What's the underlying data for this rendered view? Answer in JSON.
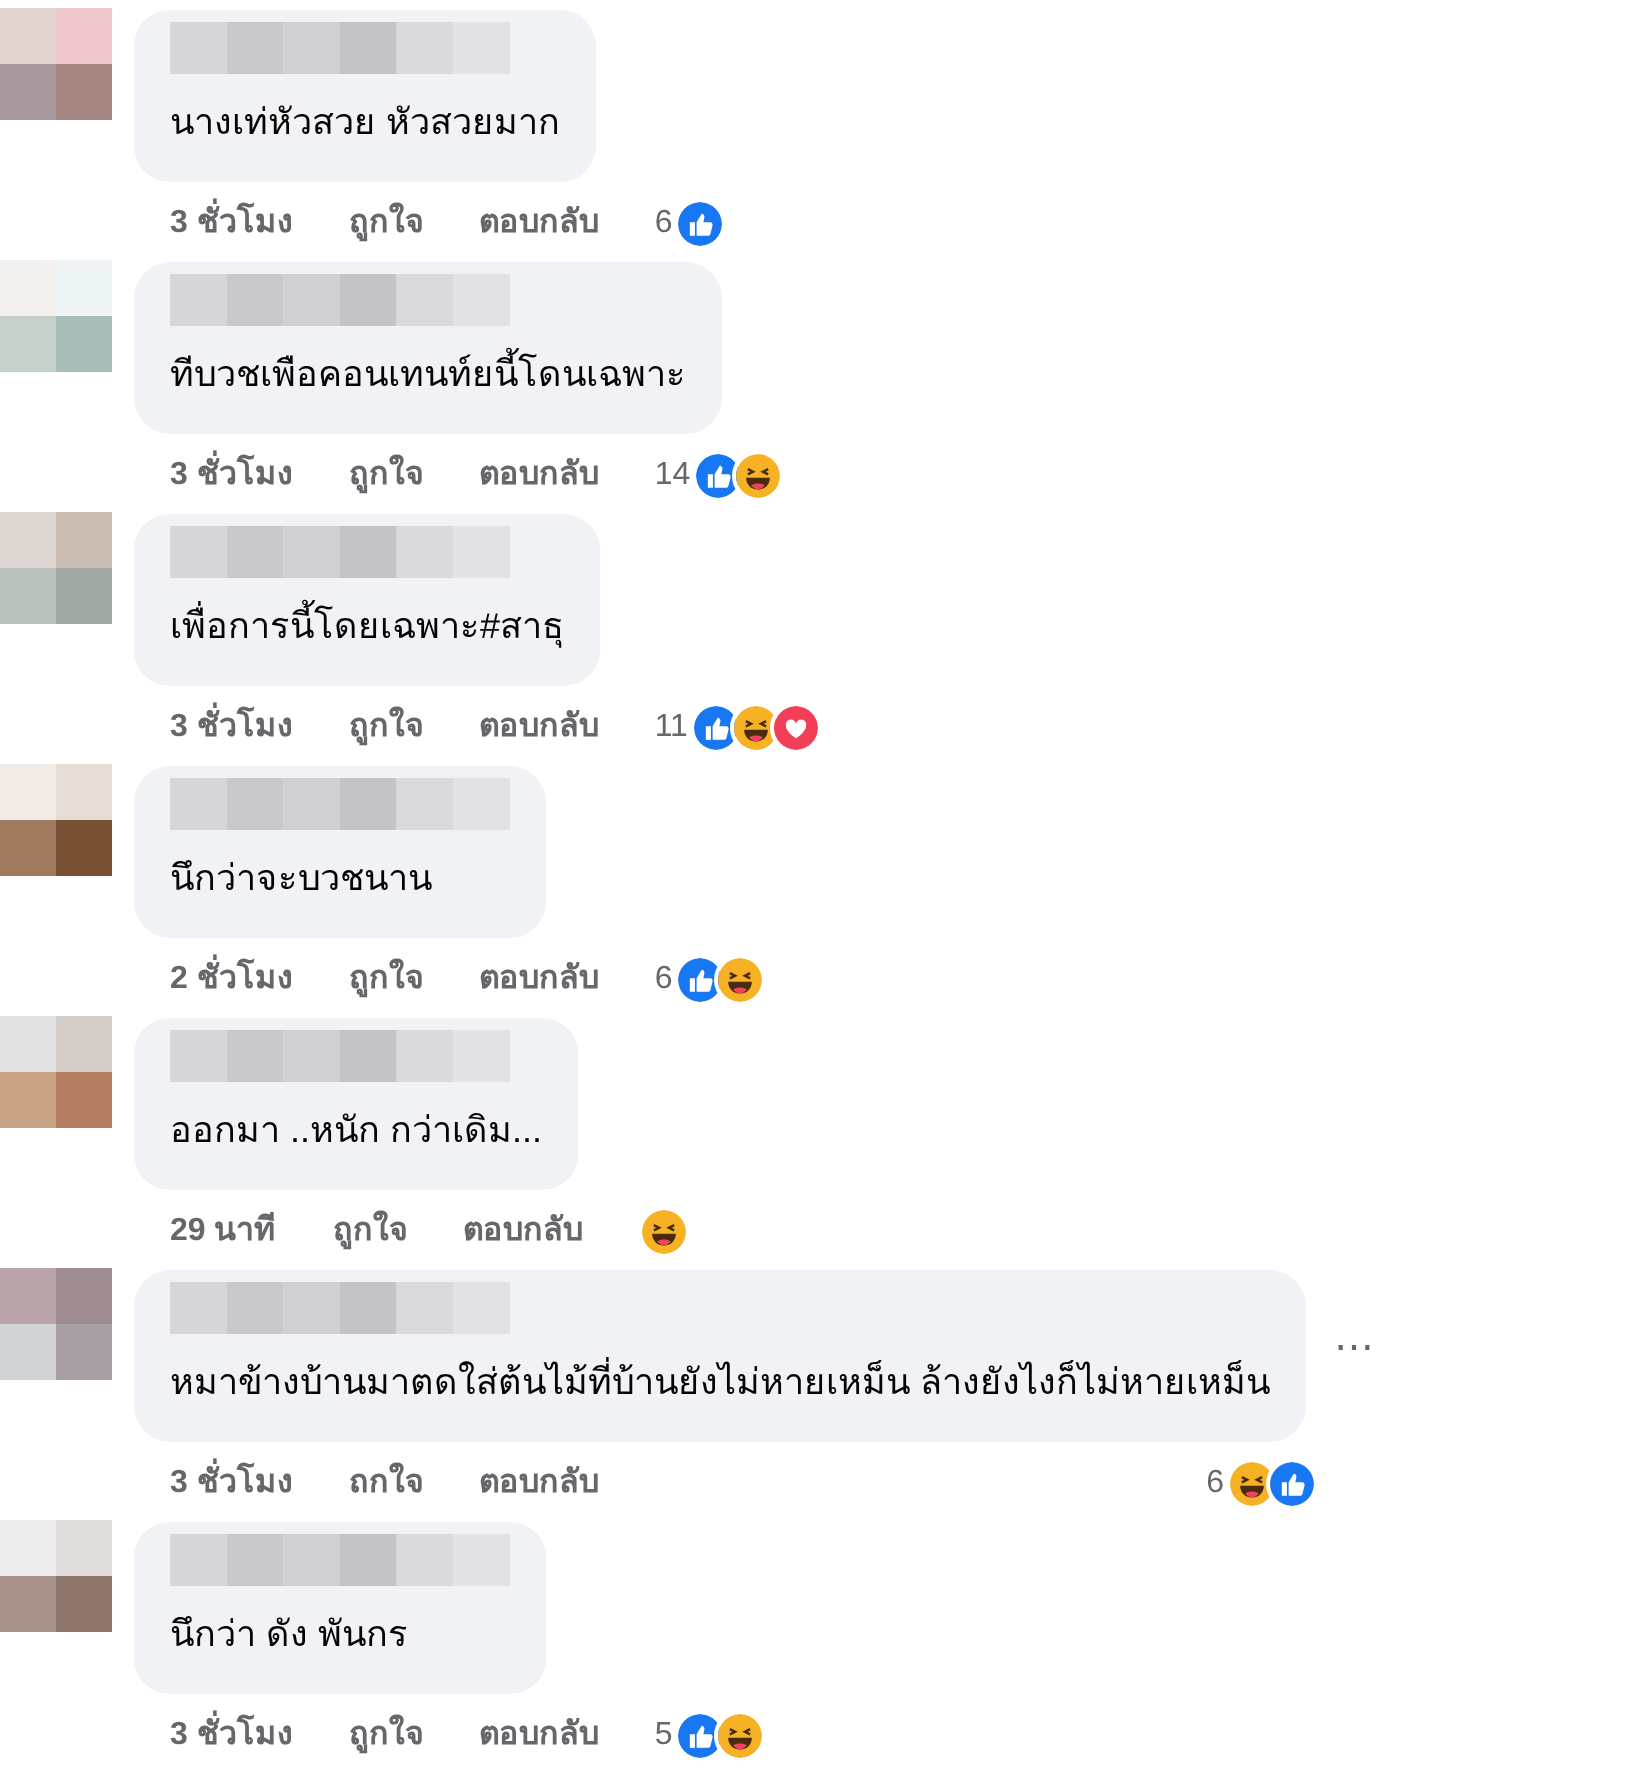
{
  "comments": [
    {
      "text": "นางเท่หัวสวย หัวสวยมาก",
      "time": "3 ชั่วโมง",
      "like": "ถูกใจ",
      "reply": "ตอบกลับ",
      "count": "6",
      "reactions": [
        {
          "kind": "like"
        }
      ]
    },
    {
      "text": "ทีบวชเพือคอนเทนท์ยนี้โดนเฉพาะ",
      "time": "3 ชั่วโมง",
      "like": "ถูกใจ",
      "reply": "ตอบกลับ",
      "count": "14",
      "reactions": [
        {
          "kind": "like"
        },
        {
          "kind": "haha"
        }
      ]
    },
    {
      "text": "เพื่อการนี้โดยเฉพาะ#สาธุ",
      "time": "3 ชั่วโมง",
      "like": "ถูกใจ",
      "reply": "ตอบกลับ",
      "count": "11",
      "reactions": [
        {
          "kind": "like"
        },
        {
          "kind": "haha"
        },
        {
          "kind": "love"
        }
      ]
    },
    {
      "text": "นึกว่าจะบวชนาน",
      "time": "2 ชั่วโมง",
      "like": "ถูกใจ",
      "reply": "ตอบกลับ",
      "count": "6",
      "reactions": [
        {
          "kind": "like"
        },
        {
          "kind": "haha"
        }
      ]
    },
    {
      "text": "ออกมา ..หนัก กว่าเดิม...",
      "time": "29 นาที",
      "like": "ถูกใจ",
      "reply": "ตอบกลับ",
      "reactions": [
        {
          "kind": "haha"
        }
      ]
    },
    {
      "text": "หมาข้างบ้านมาตดใส่ต้นไม้ที่บ้านยังไม่หายเหม็น ล้างยังไงก็ไม่หายเหม็น",
      "time": "3 ชั่วโมง",
      "like": "ถกใจ",
      "reply": "ตอบกลับ",
      "count": "6",
      "reactions": [
        {
          "kind": "haha"
        },
        {
          "kind": "like"
        }
      ],
      "more_button": "⋯"
    },
    {
      "text": "นึกว่า ดัง พันกร",
      "time": "3 ชั่วโมง",
      "like": "ถูกใจ",
      "reply": "ตอบกลับ",
      "count": "5",
      "reactions": [
        {
          "kind": "like"
        },
        {
          "kind": "haha"
        }
      ]
    }
  ]
}
